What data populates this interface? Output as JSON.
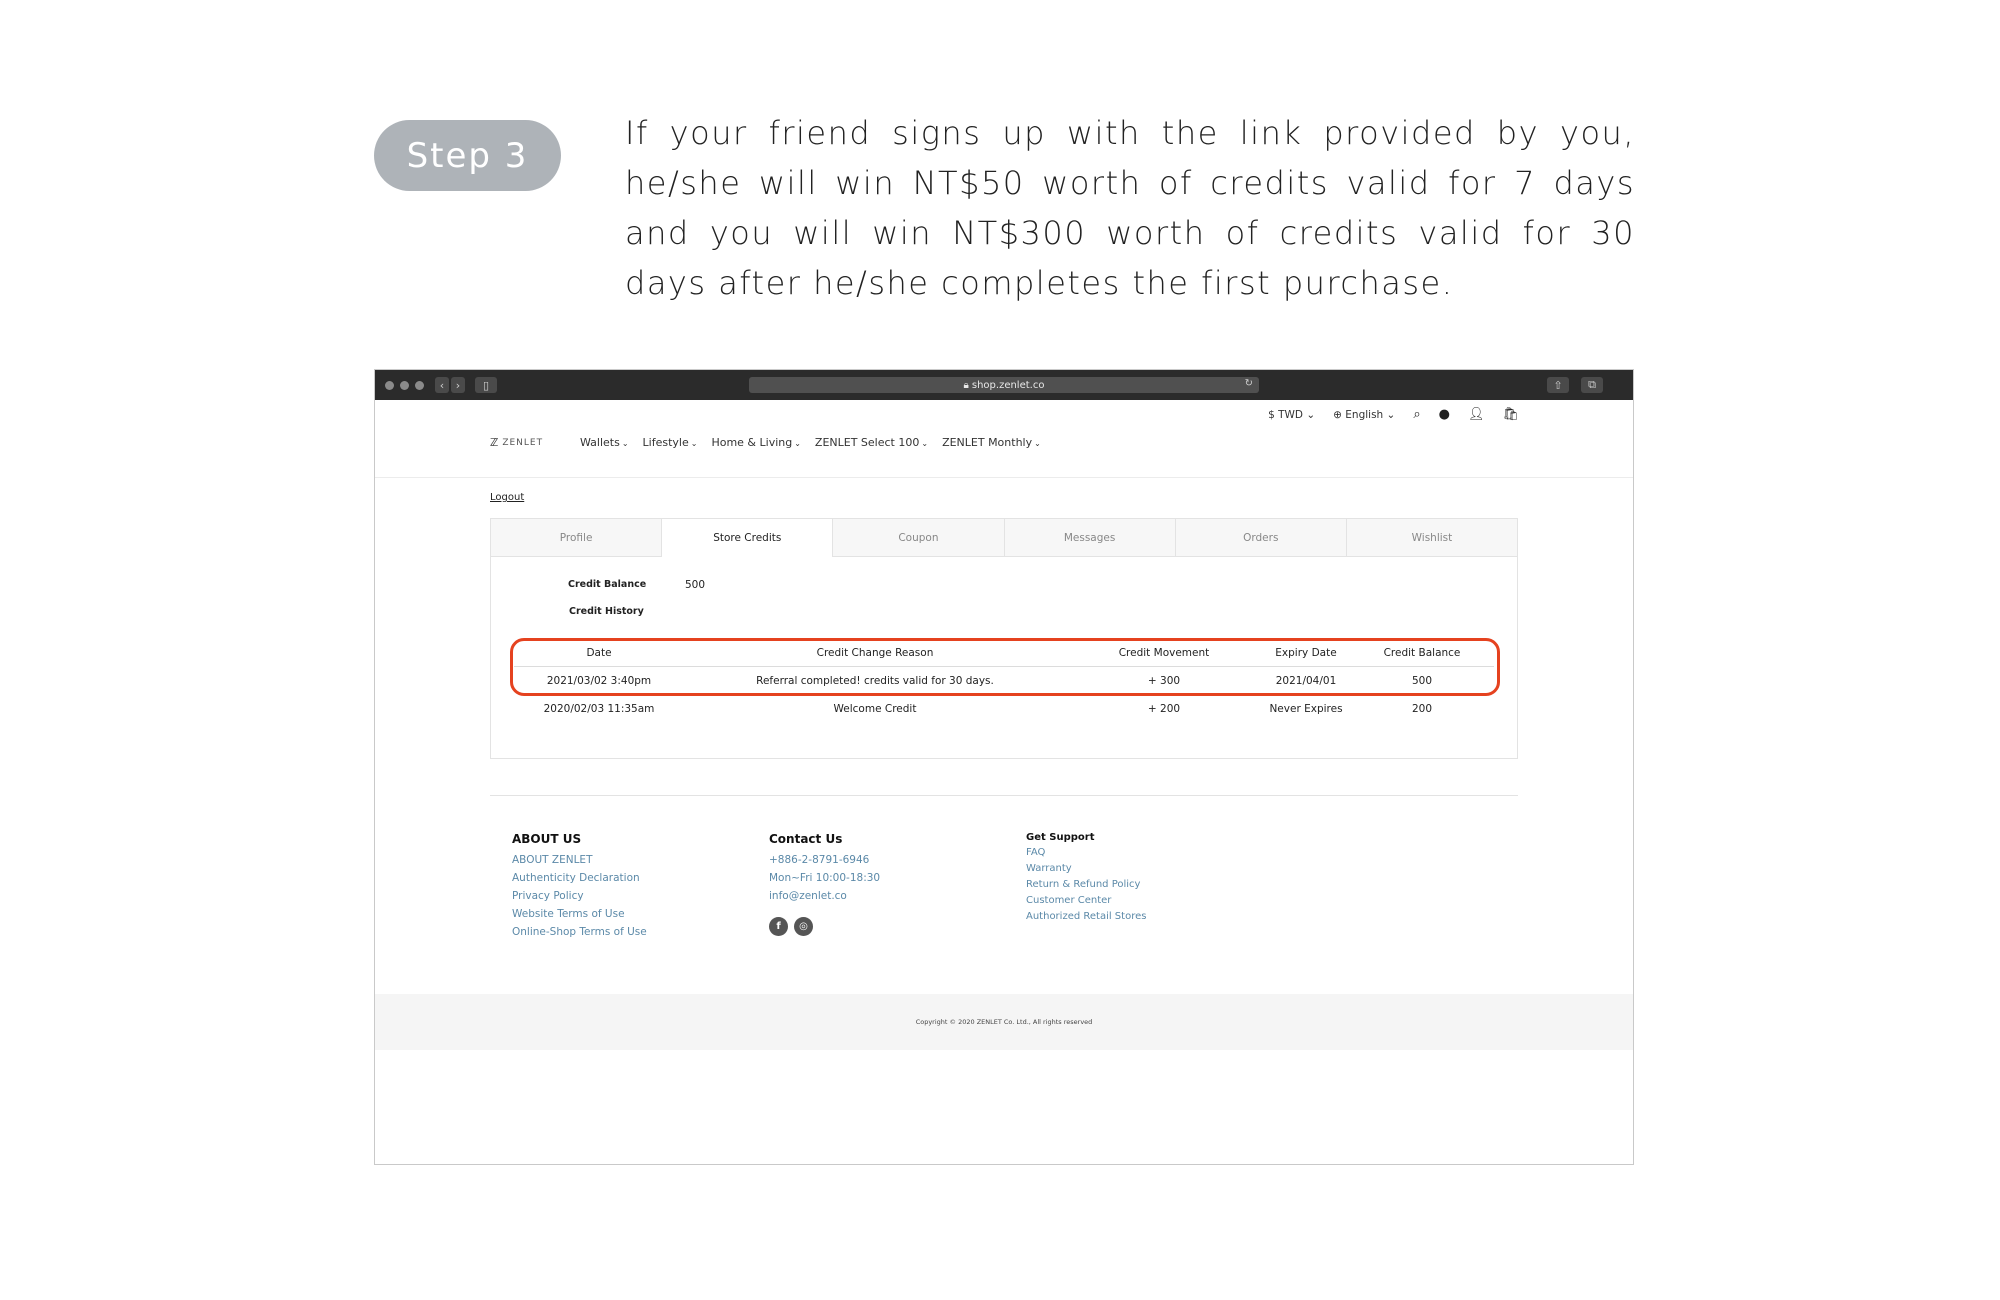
{
  "step": {
    "label": "Step 3"
  },
  "instruction": "If your friend signs up with the link provided by you, he/she will win NT$50 worth of credits valid for 7 days and you will win NT$300 worth of credits valid for 30 days after he/she completes the first purchase.",
  "browser": {
    "url": "shop.zenlet.co",
    "lock_icon": "lock-icon",
    "reload_icon": "reload-icon"
  },
  "site": {
    "logo": "ZENLET",
    "currency": "$ TWD",
    "language": "English",
    "nav": [
      "Wallets",
      "Lifestyle",
      "Home & Living",
      "ZENLET Select 100",
      "ZENLET Monthly"
    ],
    "logout": "Logout"
  },
  "tabs": [
    "Profile",
    "Store Credits",
    "Coupon",
    "Messages",
    "Orders",
    "Wishlist"
  ],
  "active_tab": "Store Credits",
  "credits": {
    "balance_label": "Credit Balance",
    "balance_value": "500",
    "history_label": "Credit History",
    "columns": [
      "Date",
      "Credit Change Reason",
      "Credit Movement",
      "Expiry Date",
      "Credit Balance"
    ],
    "rows": [
      [
        "2021/03/02 3:40pm",
        "Referral completed! credits valid for 30 days.",
        "+ 300",
        "2021/04/01",
        "500"
      ],
      [
        "2020/02/03 11:35am",
        "Welcome Credit",
        "+ 200",
        "Never Expires",
        "200"
      ]
    ]
  },
  "footer": {
    "about_title": "ABOUT US",
    "about_links": [
      "ABOUT ZENLET",
      "Authenticity Declaration",
      "Privacy Policy",
      "Website Terms of Use",
      "Online-Shop Terms of Use"
    ],
    "contact_title": "Contact Us",
    "contact_lines": [
      "+886-2-8791-6946",
      "Mon~Fri 10:00-18:30",
      "info@zenlet.co"
    ],
    "support_title": "Get Support",
    "support_links": [
      "FAQ",
      "Warranty",
      "Return & Refund Policy",
      "Customer Center",
      "Authorized Retail Stores"
    ],
    "copyright": "Copyright © 2020 ZENLET Co. Ltd., All rights reserved"
  },
  "colors": {
    "highlight": "#e5421f",
    "step_pill": "#aeb3b8",
    "footer_link": "#5b89a8"
  }
}
